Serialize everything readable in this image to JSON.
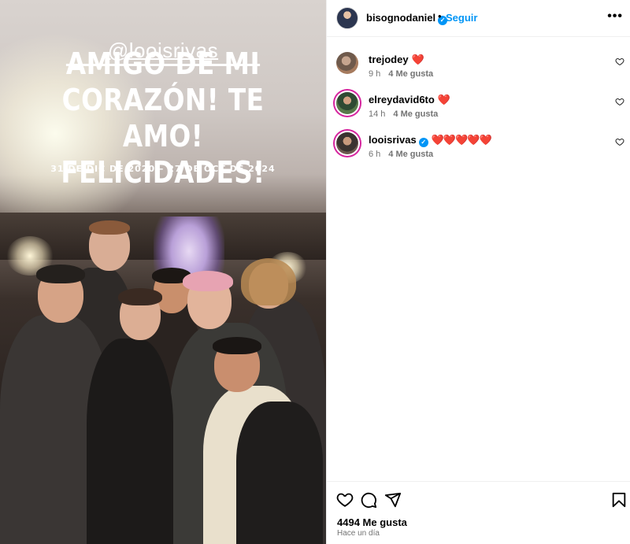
{
  "media": {
    "mention": "@looisrivas",
    "headline_line1": "AMIGO DE MI",
    "headline_line2": "CORAZÓN! TE AMO!",
    "headline_line3": "FELICIDADES!",
    "dates": "31 DE DIC DE 2020 – 27 DE OCT DE 2024"
  },
  "header": {
    "username": "bisognodaniel",
    "separator": "•",
    "follow_label": "Seguir",
    "more_label": "•••"
  },
  "comments": [
    {
      "user": "trejodey",
      "text": "❤️",
      "time": "9 h",
      "likes": "4 Me gusta"
    },
    {
      "user": "elreydavid6to",
      "text": "❤️",
      "time": "14 h",
      "likes": "4 Me gusta"
    },
    {
      "user": "looisrivas",
      "text": "❤️❤️❤️❤️❤️",
      "time": "6 h",
      "likes": "4 Me gusta",
      "verified": true
    }
  ],
  "footer": {
    "likes": "4494 Me gusta",
    "time_ago": "Hace un día"
  },
  "colors": {
    "accent": "#0095f6",
    "muted": "#737373",
    "heart": "#ed1c24"
  }
}
